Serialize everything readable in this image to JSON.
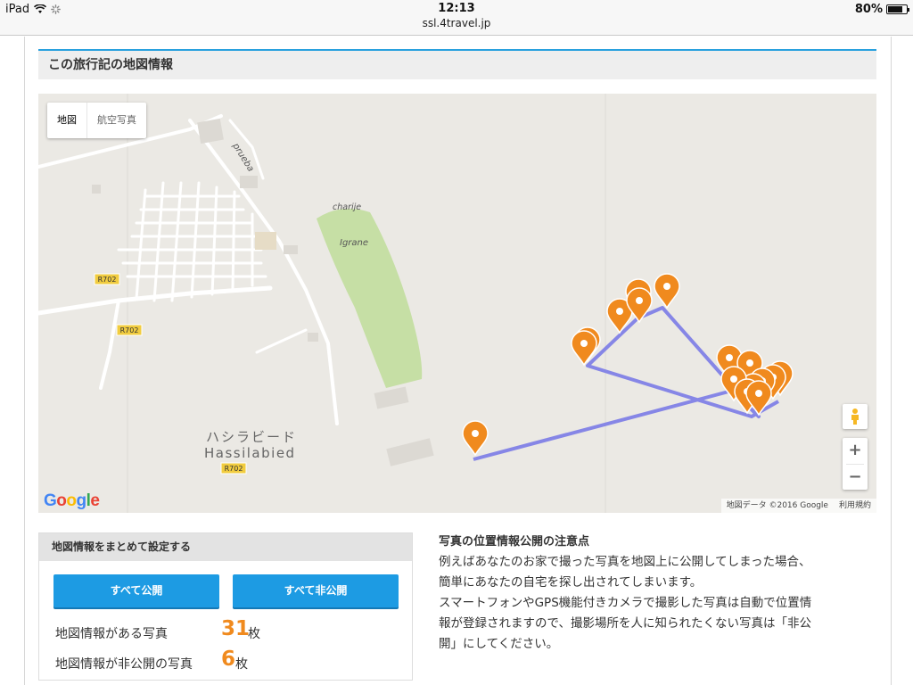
{
  "status_bar": {
    "device": "iPad",
    "time": "12:13",
    "url": "ssl.4travel.jp",
    "battery": "80%",
    "battery_level": 0.8
  },
  "section": {
    "title": "この旅行記の地図情報"
  },
  "map": {
    "type_buttons": [
      "地図",
      "航空写真"
    ],
    "labels": {
      "prueba": "prueba",
      "charije": "charije",
      "igrane": "Igrane",
      "hassilabied_jp": "ハシラビード",
      "hassilabied": "Hassilabied",
      "road1": "R702",
      "road2": "R702",
      "road3": "R702"
    },
    "zoom_in": "+",
    "zoom_out": "−",
    "logo": "Google",
    "attribution": "地図データ ©2016 Google",
    "terms": "利用規約",
    "colors": {
      "pin": "#f08a1e",
      "route": "#7b7be6",
      "land": "#ebe9e4",
      "park": "#c6dfa5"
    }
  },
  "settings": {
    "title": "地図情報をまとめて設定する",
    "public_all": "すべて公開",
    "private_all": "すべて非公開",
    "with_location_label": "地図情報がある写真",
    "with_location_count": "31",
    "private_label": "地図情報が非公開の写真",
    "private_count": "6",
    "unit": "枚"
  },
  "notes": {
    "title": "写真の位置情報公開の注意点",
    "line1": "例えばあなたのお家で撮った写真を地図上に公開してしまった場合、",
    "line2": "簡単にあなたの自宅を探し出されてしまいます。",
    "line3": "スマートフォンやGPS機能付きカメラで撮影した写真は自動で位置情",
    "line4": "報が登録されますので、撮影場所を人に知られたくない写真は「非公",
    "line5": "開」にしてください。"
  }
}
